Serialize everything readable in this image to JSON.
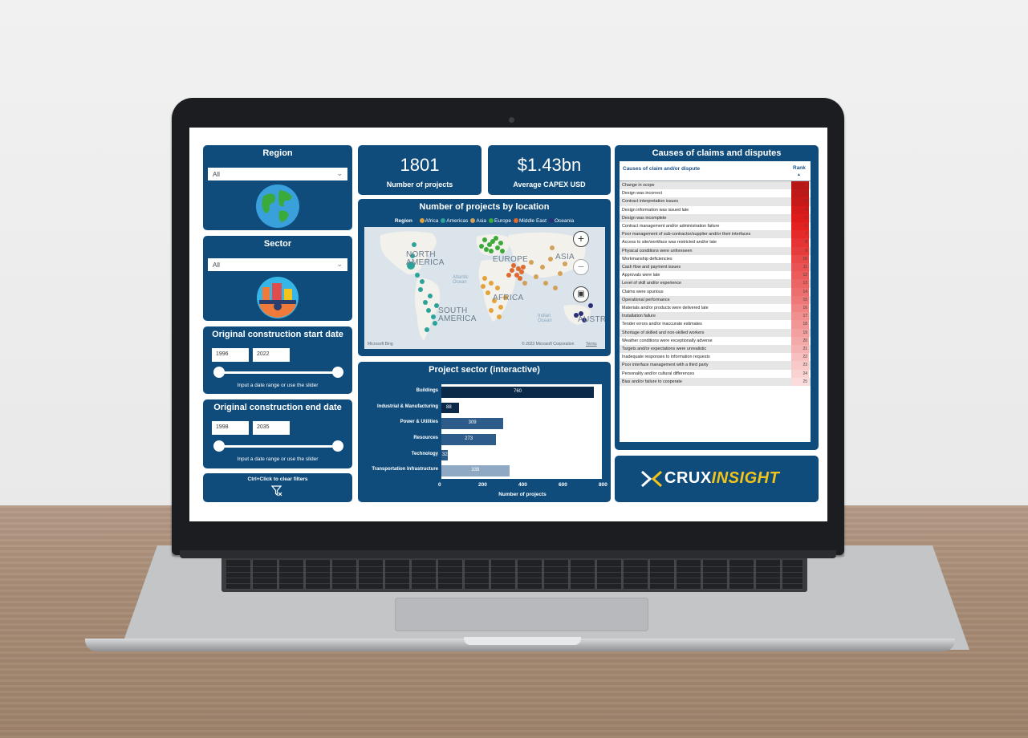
{
  "region": {
    "title": "Region",
    "select_value": "All"
  },
  "sector": {
    "title": "Sector",
    "select_value": "All"
  },
  "start_date": {
    "title": "Original construction start date",
    "from": "1996",
    "to": "2022",
    "hint": "Input a date range or use the slider"
  },
  "end_date": {
    "title": "Original construction end date",
    "from": "1998",
    "to": "2035",
    "hint": "Input a date range or use the slider"
  },
  "clear_filters": {
    "label": "Ctrl+Click to clear filters"
  },
  "kpis": [
    {
      "value": "1801",
      "label": "Number of projects"
    },
    {
      "value": "$1.43bn",
      "label": "Average CAPEX USD"
    }
  ],
  "map": {
    "title": "Number of projects by location",
    "legend_title": "Region",
    "legend": [
      {
        "name": "Africa",
        "color": "#e3a23a"
      },
      {
        "name": "Americas",
        "color": "#2aa39a"
      },
      {
        "name": "Asia",
        "color": "#d2a15a"
      },
      {
        "name": "Europe",
        "color": "#3aab3a"
      },
      {
        "name": "Middle East",
        "color": "#e06a2e"
      },
      {
        "name": "Oceania",
        "color": "#2a2f78"
      }
    ],
    "labels": {
      "north_america": "NORTH AMERICA",
      "europe": "EUROPE",
      "asia": "ASIA",
      "africa": "AFRICA",
      "south_america": "SOUTH AMERICA",
      "australia": "AUSTRA",
      "atlantic": "Atlantic Ocean",
      "indian": "Indian Ocean"
    },
    "attribution_left": "Microsoft Bing",
    "attribution_right": "© 2023 Microsoft Corporation",
    "terms": "Terms"
  },
  "sector_chart": {
    "title": "Project sector (interactive)",
    "xlabel": "Number of projects"
  },
  "chart_data": {
    "type": "bar",
    "title": "Project sector (interactive)",
    "categories": [
      "Buildings",
      "Industrial & Manufacturing",
      "Power & Utilities",
      "Resources",
      "Technology",
      "Transportation Infrastructure"
    ],
    "values": [
      760,
      88,
      309,
      273,
      32,
      339
    ],
    "value_labels": [
      "760",
      "88",
      "309",
      "273",
      "32",
      "339"
    ],
    "xlabel": "Number of projects",
    "ylabel": "",
    "xlim": [
      0,
      800
    ],
    "xticks": [
      "0",
      "200",
      "400",
      "600",
      "800"
    ],
    "bar_colors": [
      "#0b2a4a",
      "#0b2a4a",
      "#2d5b8a",
      "#2d5b8a",
      "#2d5b8a",
      "#8fa9c4"
    ]
  },
  "causes": {
    "title": "Causes of claims and disputes",
    "col1": "Causes of claim and/or dispute",
    "col2": "Rank",
    "rows": [
      {
        "cause": "Change in scope",
        "rank": "1"
      },
      {
        "cause": "Design was incorrect",
        "rank": "2"
      },
      {
        "cause": "Contract interpretation issues",
        "rank": "3"
      },
      {
        "cause": "Design information was issued late",
        "rank": "4"
      },
      {
        "cause": "Design was incomplete",
        "rank": "5"
      },
      {
        "cause": "Contract management and/or administration failure",
        "rank": "6"
      },
      {
        "cause": "Poor management of sub-contractor/supplier and/or their interfaces",
        "rank": "7"
      },
      {
        "cause": "Access to site/workface was restricted and/or late",
        "rank": "8"
      },
      {
        "cause": "Physical conditions were unforeseen",
        "rank": "9"
      },
      {
        "cause": "Workmanship deficiencies",
        "rank": "10"
      },
      {
        "cause": "Cash flow and payment issues",
        "rank": "11"
      },
      {
        "cause": "Approvals were late",
        "rank": "12"
      },
      {
        "cause": "Level of skill and/or experience",
        "rank": "13"
      },
      {
        "cause": "Claims were spurious",
        "rank": "14"
      },
      {
        "cause": "Operational performance",
        "rank": "15"
      },
      {
        "cause": "Materials and/or products were delivered late",
        "rank": "16"
      },
      {
        "cause": "Installation failure",
        "rank": "17"
      },
      {
        "cause": "Tender errors and/or inaccurate estimates",
        "rank": "18"
      },
      {
        "cause": "Shortage of skilled and non-skilled workers",
        "rank": "19"
      },
      {
        "cause": "Weather conditions were exceptionally adverse",
        "rank": "20"
      },
      {
        "cause": "Targets and/or expectations were unrealistic",
        "rank": "21"
      },
      {
        "cause": "Inadequate responses to information requests",
        "rank": "22"
      },
      {
        "cause": "Poor interface management with a third party",
        "rank": "23"
      },
      {
        "cause": "Personality and/or cultural differences",
        "rank": "24"
      },
      {
        "cause": "Bias and/or failure to cooperate",
        "rank": "25"
      }
    ]
  },
  "brand": {
    "part1": "CRUX",
    "part2": "INSIGHT",
    "color1": "#ffffff",
    "color2": "#f2c318"
  }
}
